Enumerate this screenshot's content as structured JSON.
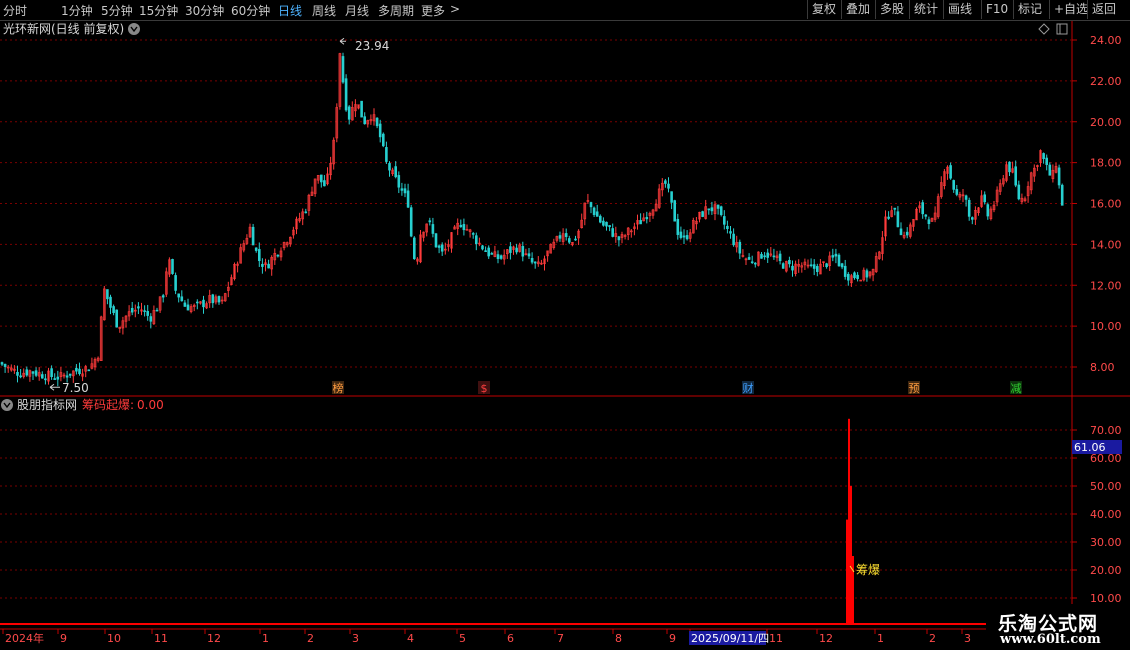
{
  "toolbar": {
    "periods": [
      {
        "label": "分时",
        "active": false
      },
      {
        "label": "1分钟",
        "active": false
      },
      {
        "label": "5分钟",
        "active": false
      },
      {
        "label": "15分钟",
        "active": false
      },
      {
        "label": "30分钟",
        "active": false
      },
      {
        "label": "60分钟",
        "active": false
      },
      {
        "label": "日线",
        "active": true
      },
      {
        "label": "周线",
        "active": false
      },
      {
        "label": "月线",
        "active": false
      },
      {
        "label": "多周期",
        "active": false
      },
      {
        "label": "更多",
        "active": false
      }
    ],
    "more_arrow": ">",
    "buttons": [
      "复权",
      "叠加",
      "多股",
      "统计",
      "画线",
      "F10",
      "标记",
      "+自选",
      "返回"
    ]
  },
  "main_panel": {
    "title": "光环新网(日线 前复权)",
    "high_label": "23.94",
    "low_label": "7.50",
    "event_markers": [
      {
        "label": "榜",
        "color": "#ff9c40"
      },
      {
        "label": "$",
        "color": "#ff4040"
      },
      {
        "label": "财",
        "color": "#40a0ff"
      },
      {
        "label": "预",
        "color": "#ff9c40"
      },
      {
        "label": "减",
        "color": "#30d030"
      }
    ]
  },
  "sub_panel": {
    "indicator_name": "股朋指标网",
    "line_name": "筹码起爆:",
    "line_value": "0.00",
    "current_value_tag": "61.06",
    "signal_label": "筹爆"
  },
  "time_axis": {
    "labels": [
      "2024年",
      "9",
      "10",
      "11",
      "12",
      "1",
      "2",
      "3",
      "4",
      "5",
      "6",
      "7",
      "8",
      "9",
      "2025/09/11/四",
      "11",
      "12",
      "1",
      "2",
      "3"
    ]
  },
  "watermark": {
    "name": "乐淘公式网",
    "url": "www.60lt.com"
  },
  "colors": {
    "up": "#ff3b3b",
    "down": "#27d0d0",
    "grid": "#7a0000",
    "axis": "#c00000",
    "label": "#ff4a4a",
    "signal": "#ff0000",
    "signal_text": "#ffe030"
  },
  "chart_data": [
    {
      "type": "candlestick",
      "title": "光环新网(日线 前复权)",
      "y_ticks": [
        "24.00",
        "22.00",
        "20.00",
        "18.00",
        "16.00",
        "14.00",
        "12.00",
        "10.00",
        "8.00"
      ],
      "ylim": [
        7.0,
        24.6
      ],
      "x_months": [
        "2024-08",
        "2024-09",
        "2024-10",
        "2024-11",
        "2024-12",
        "2025-01",
        "2025-02",
        "2025-03",
        "2025-04",
        "2025-05",
        "2025-06",
        "2025-07",
        "2025-08",
        "2025-09",
        "2025-10",
        "2025-11",
        "2025-12",
        "2026-01",
        "2026-02",
        "2026-03"
      ],
      "close_path": [
        [
          0,
          8.2
        ],
        [
          10,
          7.9
        ],
        [
          20,
          7.7
        ],
        [
          30,
          7.8
        ],
        [
          45,
          7.6
        ],
        [
          60,
          7.5
        ],
        [
          75,
          7.8
        ],
        [
          90,
          8.0
        ],
        [
          98,
          8.6
        ],
        [
          104,
          11.8
        ],
        [
          110,
          11.0
        ],
        [
          118,
          10.0
        ],
        [
          128,
          10.6
        ],
        [
          140,
          10.9
        ],
        [
          150,
          10.4
        ],
        [
          158,
          11.0
        ],
        [
          163,
          11.5
        ],
        [
          168,
          13.4
        ],
        [
          175,
          11.8
        ],
        [
          185,
          11.0
        ],
        [
          195,
          10.9
        ],
        [
          210,
          11.3
        ],
        [
          222,
          11.1
        ],
        [
          230,
          12.2
        ],
        [
          240,
          13.6
        ],
        [
          250,
          14.8
        ],
        [
          258,
          13.3
        ],
        [
          266,
          12.9
        ],
        [
          276,
          13.6
        ],
        [
          286,
          14.2
        ],
        [
          296,
          15.0
        ],
        [
          306,
          15.8
        ],
        [
          316,
          17.4
        ],
        [
          326,
          16.8
        ],
        [
          334,
          19.0
        ],
        [
          337,
          21.0
        ],
        [
          340,
          23.5
        ],
        [
          343,
          22.0
        ],
        [
          348,
          20.1
        ],
        [
          356,
          21.1
        ],
        [
          364,
          20.0
        ],
        [
          372,
          20.4
        ],
        [
          380,
          19.3
        ],
        [
          386,
          18.0
        ],
        [
          395,
          17.2
        ],
        [
          402,
          16.6
        ],
        [
          408,
          16.1
        ],
        [
          412,
          14.0
        ],
        [
          416,
          12.9
        ],
        [
          420,
          14.5
        ],
        [
          428,
          15.2
        ],
        [
          436,
          14.0
        ],
        [
          443,
          13.5
        ],
        [
          450,
          14.2
        ],
        [
          460,
          15.1
        ],
        [
          470,
          14.6
        ],
        [
          480,
          14.0
        ],
        [
          490,
          13.5
        ],
        [
          500,
          13.3
        ],
        [
          510,
          13.7
        ],
        [
          518,
          13.9
        ],
        [
          526,
          13.4
        ],
        [
          534,
          13.0
        ],
        [
          540,
          12.9
        ],
        [
          548,
          13.6
        ],
        [
          556,
          14.1
        ],
        [
          564,
          14.7
        ],
        [
          572,
          14.0
        ],
        [
          580,
          14.8
        ],
        [
          586,
          16.2
        ],
        [
          594,
          15.6
        ],
        [
          602,
          15.0
        ],
        [
          612,
          14.6
        ],
        [
          620,
          14.2
        ],
        [
          628,
          14.6
        ],
        [
          640,
          15.1
        ],
        [
          652,
          15.8
        ],
        [
          660,
          16.6
        ],
        [
          666,
          17.0
        ],
        [
          672,
          15.8
        ],
        [
          678,
          14.6
        ],
        [
          684,
          14.2
        ],
        [
          692,
          14.9
        ],
        [
          700,
          15.4
        ],
        [
          708,
          15.8
        ],
        [
          716,
          15.7
        ],
        [
          724,
          15.0
        ],
        [
          732,
          14.3
        ],
        [
          740,
          13.6
        ],
        [
          748,
          13.2
        ],
        [
          756,
          13.3
        ],
        [
          764,
          13.6
        ],
        [
          772,
          13.4
        ],
        [
          780,
          13.1
        ],
        [
          790,
          12.9
        ],
        [
          800,
          13.0
        ],
        [
          810,
          12.8
        ],
        [
          820,
          12.9
        ],
        [
          830,
          13.2
        ],
        [
          836,
          13.4
        ],
        [
          842,
          12.8
        ],
        [
          850,
          12.4
        ],
        [
          858,
          12.5
        ],
        [
          866,
          12.5
        ],
        [
          874,
          12.7
        ],
        [
          880,
          14.0
        ],
        [
          886,
          15.2
        ],
        [
          892,
          15.9
        ],
        [
          898,
          15.0
        ],
        [
          904,
          14.4
        ],
        [
          910,
          14.8
        ],
        [
          918,
          15.8
        ],
        [
          926,
          15.4
        ],
        [
          934,
          15.0
        ],
        [
          940,
          16.6
        ],
        [
          946,
          18.2
        ],
        [
          952,
          17.0
        ],
        [
          958,
          16.2
        ],
        [
          964,
          16.5
        ],
        [
          970,
          15.2
        ],
        [
          976,
          15.8
        ],
        [
          982,
          16.2
        ],
        [
          988,
          15.4
        ],
        [
          994,
          16.0
        ],
        [
          1000,
          16.8
        ],
        [
          1006,
          17.9
        ],
        [
          1012,
          17.6
        ],
        [
          1018,
          16.3
        ],
        [
          1024,
          16.2
        ],
        [
          1030,
          17.4
        ],
        [
          1036,
          17.8
        ],
        [
          1040,
          18.6
        ],
        [
          1046,
          17.8
        ],
        [
          1052,
          17.2
        ],
        [
          1056,
          18.0
        ],
        [
          1060,
          16.5
        ],
        [
          1064,
          15.6
        ]
      ]
    },
    {
      "type": "bar",
      "title": "股朋指标网",
      "series": [
        {
          "name": "筹码起爆",
          "values": [
            0.0,
            38.0,
            74.0,
            50.0,
            25.0,
            0.0
          ]
        }
      ],
      "y_ticks": [
        "70.00",
        "60.00",
        "50.00",
        "40.00",
        "30.00",
        "20.00",
        "10.00"
      ],
      "ylim": [
        0,
        78
      ],
      "current_value": 61.06,
      "signal_date_position": "2025-12"
    }
  ]
}
